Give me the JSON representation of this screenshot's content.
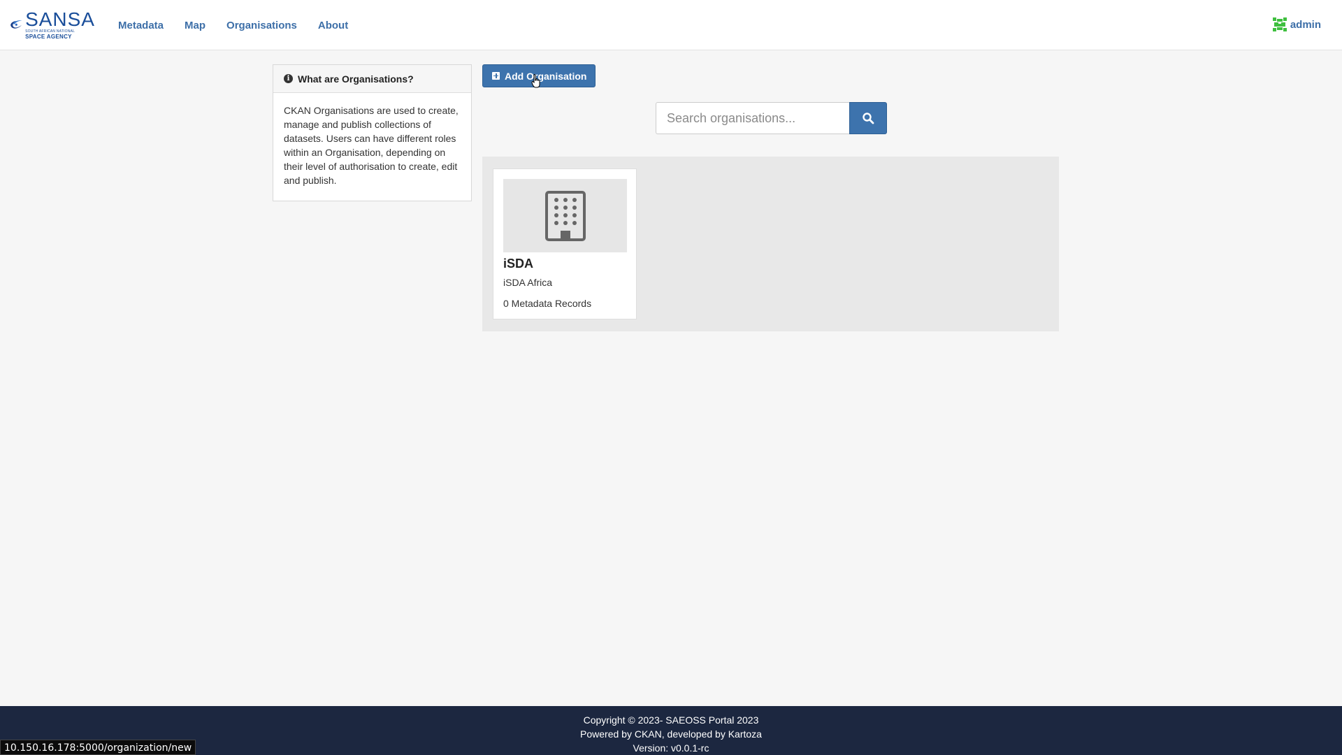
{
  "header": {
    "logo": {
      "main": "SANSA",
      "sub1": "SOUTH AFRICAN NATIONAL",
      "sub2": "SPACE AGENCY"
    },
    "nav": [
      {
        "label": "Metadata"
      },
      {
        "label": "Map"
      },
      {
        "label": "Organisations"
      },
      {
        "label": "About"
      }
    ],
    "user": {
      "name": "admin"
    }
  },
  "sidebar": {
    "title": "What are Organisations?",
    "body": "CKAN Organisations are used to create, manage and publish collections of datasets. Users can have different roles within an Organisation, depending on their level of authorisation to create, edit and publish."
  },
  "actions": {
    "add_label": "Add Organisation"
  },
  "search": {
    "placeholder": "Search organisations...",
    "value": ""
  },
  "organizations": [
    {
      "title": "iSDA",
      "description": "iSDA Africa",
      "count_label": "0 Metadata Records"
    }
  ],
  "footer": {
    "line1": "Copyright © 2023- SAEOSS Portal 2023",
    "line2": "Powered by CKAN, developed by Kartoza",
    "line3": "Version: v0.0.1-rc"
  },
  "status_bar": {
    "url": "10.150.16.178:5000/organization/new"
  },
  "colors": {
    "primary": "#3d73ad",
    "nav_link": "#3d6fa8",
    "footer_bg": "#1c2740",
    "page_bg": "#f6f6f6"
  },
  "icons": {
    "info": "info-circle-icon",
    "add": "plus-square-icon",
    "search": "search-icon",
    "building": "building-icon",
    "avatar": "identicon-avatar"
  }
}
